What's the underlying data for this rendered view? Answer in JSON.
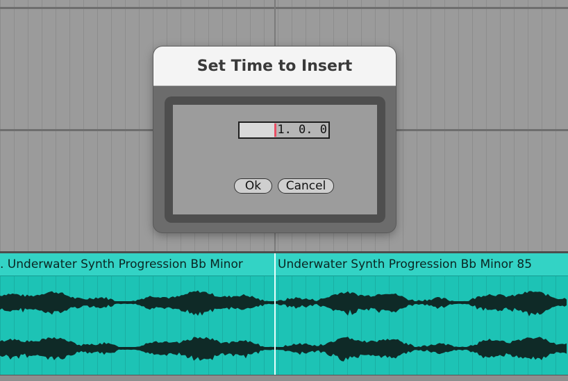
{
  "dialog": {
    "title": "Set Time to Insert",
    "time_value": "1. 0. 0",
    "ok_label": "Ok",
    "cancel_label": "Cancel"
  },
  "clips": [
    {
      "name": ". Underwater Synth Progression Bb Minor"
    },
    {
      "name": "Underwater Synth Progression Bb Minor 85"
    }
  ],
  "colors": {
    "clip": "#1dc3b5",
    "clip_header": "#33d3c5",
    "background": "#9b9b9b",
    "caret": "#e94d63"
  }
}
